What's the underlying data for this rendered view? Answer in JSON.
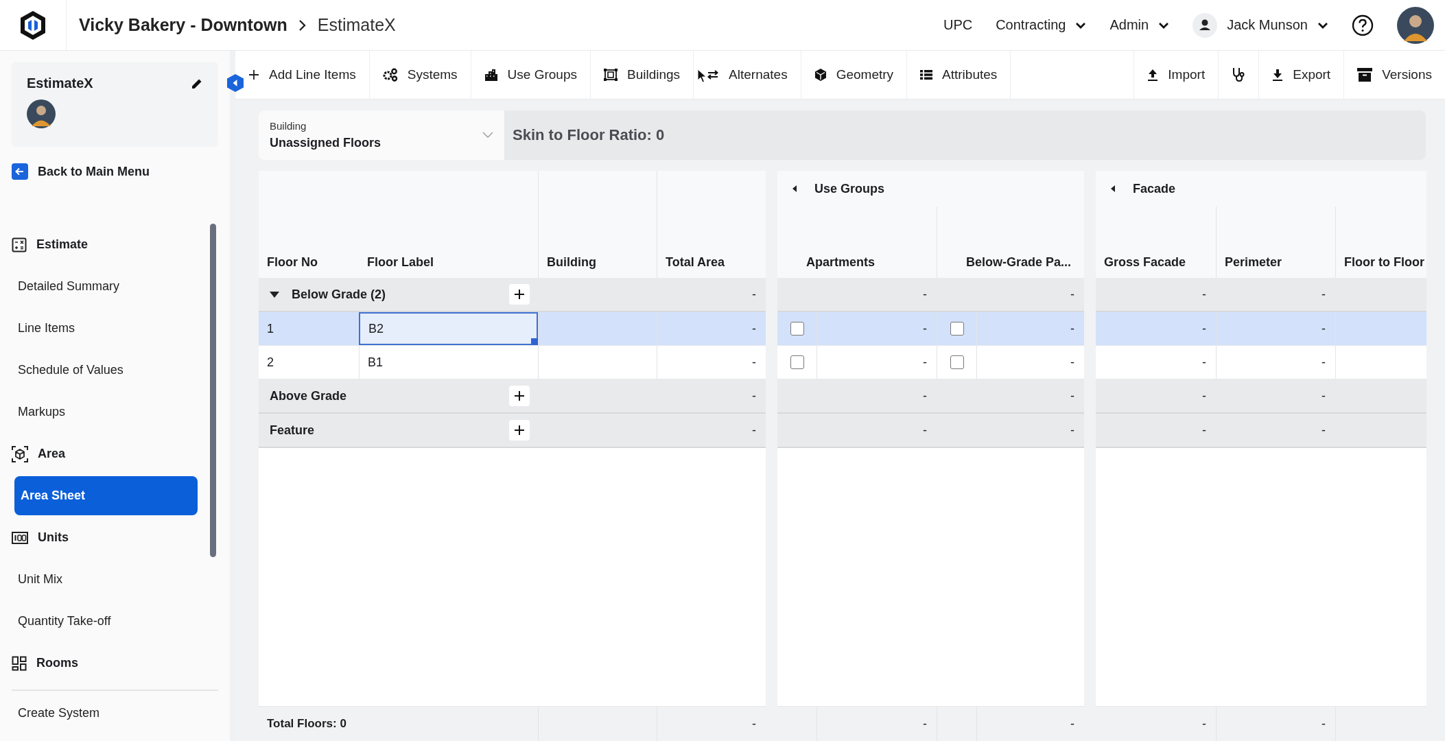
{
  "topbar": {
    "title": "Vicky Bakery - Downtown",
    "page": "EstimateX",
    "nav": [
      {
        "label": "UPC",
        "dropdown": false
      },
      {
        "label": "Contracting",
        "dropdown": true
      },
      {
        "label": "Admin",
        "dropdown": true
      }
    ],
    "user": {
      "name": "Jack Munson",
      "dropdown": true
    }
  },
  "toolbar": {
    "left": [
      "Add Line Items",
      "Systems",
      "Use Groups",
      "Buildings",
      "Alternates",
      "Geometry",
      "Attributes"
    ],
    "right": [
      {
        "kind": "text",
        "label": "Import"
      },
      {
        "kind": "icon"
      },
      {
        "kind": "text",
        "label": "Export"
      },
      {
        "kind": "text",
        "label": "Versions"
      }
    ]
  },
  "sidebar": {
    "title": "EstimateX",
    "back": "Back to Main Menu",
    "sections": [
      {
        "title": "Estimate",
        "items": [
          {
            "label": "Detailed Summary",
            "selected": false
          },
          {
            "label": "Line Items",
            "selected": false
          },
          {
            "label": "Schedule of Values",
            "selected": false
          },
          {
            "label": "Markups",
            "selected": false
          }
        ]
      },
      {
        "title": "Area",
        "items": [
          {
            "label": "Area Sheet",
            "selected": true
          }
        ]
      },
      {
        "title": "Units",
        "items": [
          {
            "label": "Unit Mix",
            "selected": false
          },
          {
            "label": "Quantity Take-off",
            "selected": false
          }
        ]
      },
      {
        "title": "Rooms"
      }
    ],
    "footer_item": "Create System"
  },
  "sheet": {
    "filter": {
      "label": "Building",
      "value": "Unassigned Floors"
    },
    "ratio": "Skin to Floor Ratio: 0",
    "columns": [
      "Floor No",
      "Floor Label",
      "Building",
      "Total Area"
    ],
    "groups": [
      {
        "title": "Use Groups",
        "columns": [
          "Apartments",
          "Below-Grade Pa..."
        ]
      },
      {
        "title": "Facade",
        "columns": [
          "Gross Facade",
          "Perimeter",
          "Floor to Floor"
        ]
      }
    ],
    "rows": [
      {
        "kind": "group",
        "title": "Below Grade (2)",
        "expanded": true,
        "selected": false,
        "values": [
          "-",
          "-",
          "-",
          "-",
          "-"
        ]
      },
      {
        "kind": "floor",
        "floor_no": "1",
        "label": "B2",
        "selected": true,
        "focused": true,
        "checks": [
          false,
          false
        ],
        "values": [
          "-",
          "-",
          "-",
          "-",
          "-"
        ]
      },
      {
        "kind": "floor",
        "floor_no": "2",
        "label": "B1",
        "selected": false,
        "focused": false,
        "checks": [
          false,
          false
        ],
        "values": [
          "-",
          "-",
          "-",
          "-",
          "-"
        ]
      },
      {
        "kind": "group",
        "title": "Above Grade",
        "expanded": false,
        "selected": false,
        "values": [
          "-",
          "-",
          "-",
          "-",
          "-"
        ]
      },
      {
        "kind": "group",
        "title": "Feature",
        "expanded": false,
        "selected": false,
        "values": [
          "-",
          "-",
          "-",
          "-",
          "-"
        ]
      }
    ],
    "footer": {
      "label": "Total Floors: 0",
      "values": [
        "-",
        "-",
        "-",
        "-",
        "-"
      ]
    }
  }
}
